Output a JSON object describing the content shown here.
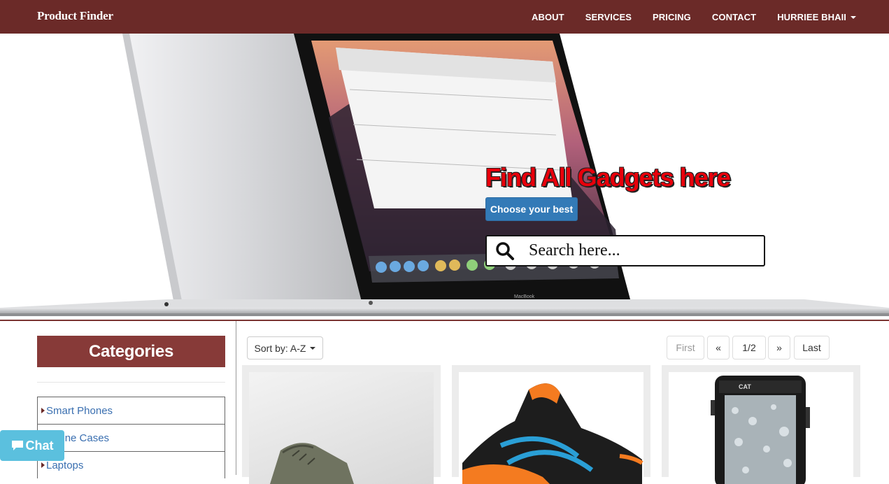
{
  "navbar": {
    "brand": "Product Finder",
    "links": [
      "ABOUT",
      "SERVICES",
      "PRICING",
      "CONTACT"
    ],
    "user": "HURRIEE BHAII"
  },
  "hero": {
    "title": "Find All Gadgets here",
    "button": "Choose your best",
    "search_placeholder": "Search here...",
    "laptop_label": "MacBook"
  },
  "sidebar": {
    "heading": "Categories",
    "items": [
      "Smart Phones",
      "Phone Cases",
      "Laptops"
    ]
  },
  "chat": {
    "label": "Chat"
  },
  "toolbar": {
    "sort_label": "Sort by: A-Z",
    "pager": {
      "first": "First",
      "prev": "«",
      "page": "1/2",
      "next": "»",
      "last": "Last"
    }
  },
  "products": [
    {
      "icon": "sneaker-image"
    },
    {
      "icon": "running-shoe-image"
    },
    {
      "icon": "rugged-phone-image"
    }
  ],
  "colors": {
    "navbar": "#6b2a28",
    "category_header": "#873a38",
    "primary_button": "#337ab7",
    "chat_button": "#5bc0de",
    "hero_title": "#e8000b"
  }
}
